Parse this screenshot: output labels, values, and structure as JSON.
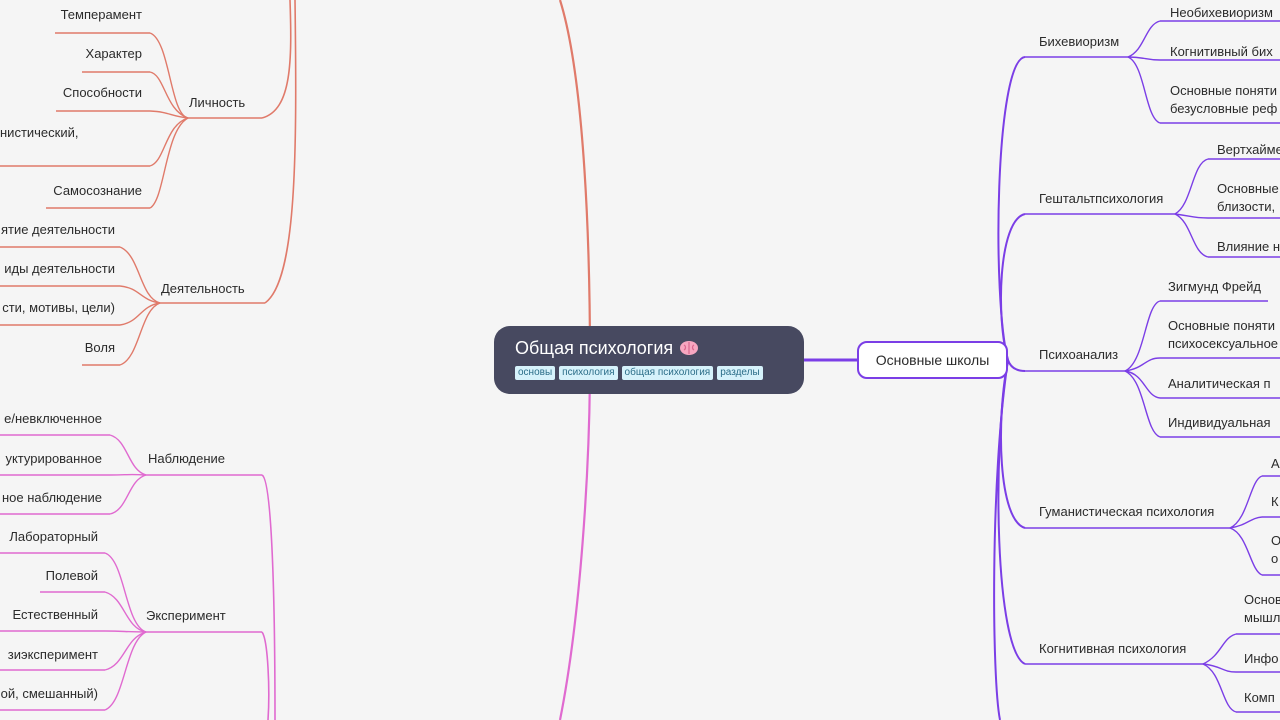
{
  "root": {
    "title": "Общая психология",
    "icon": "brain-icon",
    "tags": [
      "основы",
      "психология",
      "общая психология",
      "разделы"
    ]
  },
  "left": {
    "personality": {
      "label": "Личность",
      "children": [
        "Темперамент",
        "Характер",
        "Способности",
        "нистический,",
        "Самосознание"
      ]
    },
    "activity": {
      "label": "Деятельность",
      "children": [
        "ятие деятельности",
        "иды деятельности",
        "сти, мотивы, цели)",
        "Воля"
      ]
    },
    "observation": {
      "label": "Наблюдение",
      "children": [
        "е/невключенное",
        "уктурированное",
        "ное наблюдение"
      ]
    },
    "experiment": {
      "label": "Эксперимент",
      "children": [
        "Лабораторный",
        "Полевой",
        "Естественный",
        "зиэксперимент",
        "ой, смешанный)"
      ]
    }
  },
  "right": {
    "schools": {
      "label": "Основные школы",
      "branches": [
        {
          "label": "Бихевиоризм",
          "children": [
            "Необихевиоризм",
            "Когнитивный бих",
            "Основные поняти безусловные реф"
          ]
        },
        {
          "label": "Гештальтпсихология",
          "children": [
            "Вертхайме",
            "Основные близости,",
            "Влияние н"
          ]
        },
        {
          "label": "Психоанализ",
          "children": [
            "Зигмунд Фрейд",
            "Основные поняти психосексуальное",
            "Аналитическая п",
            "Индивидуальная"
          ]
        },
        {
          "label": "Гуманистическая психология",
          "children": [
            "А",
            "К",
            "О о"
          ]
        },
        {
          "label": "Когнитивная психология",
          "children": [
            "Основ мышл",
            "Инфо",
            "Комп"
          ]
        }
      ]
    }
  },
  "colors": {
    "background": "#f5f5f5",
    "root_fill": "#474960",
    "personality_branch": "#e07a6a",
    "method_branch": "#e06ad0",
    "schools_branch": "#7b3ee6",
    "tag_bg": "#d6f2fb"
  }
}
